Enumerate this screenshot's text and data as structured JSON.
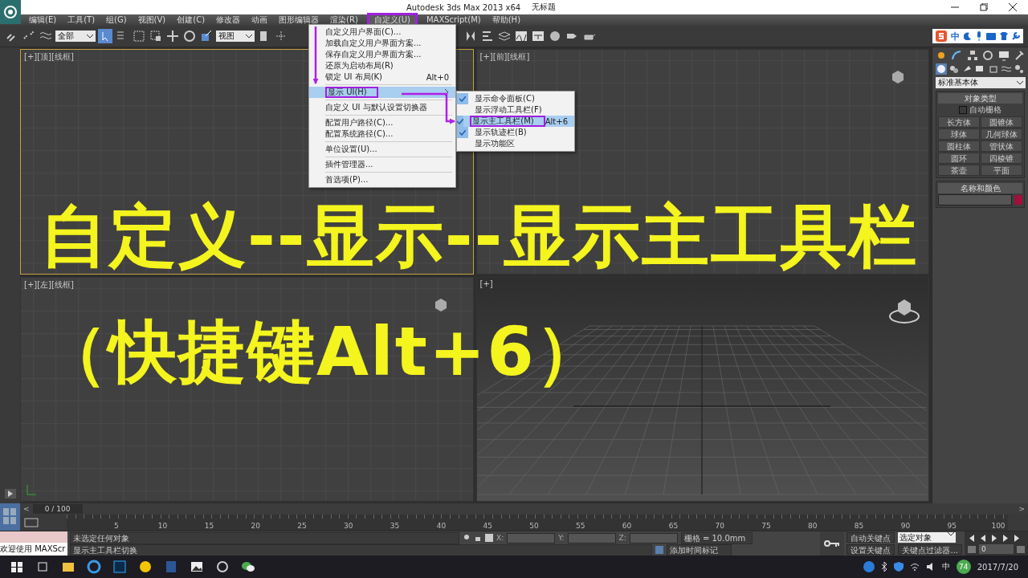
{
  "title_bar": {
    "app_title": "Autodesk 3ds Max  2013 x64",
    "document_title": "无标题"
  },
  "menu_bar": [
    {
      "label": "编辑(E)",
      "selected": false
    },
    {
      "label": "工具(T)",
      "selected": false
    },
    {
      "label": "组(G)",
      "selected": false
    },
    {
      "label": "视图(V)",
      "selected": false
    },
    {
      "label": "创建(C)",
      "selected": false
    },
    {
      "label": "修改器",
      "selected": false
    },
    {
      "label": "动画",
      "selected": false
    },
    {
      "label": "图形编辑器",
      "selected": false
    },
    {
      "label": "渲染(R)",
      "selected": false
    },
    {
      "label": "自定义(U)",
      "selected": true
    },
    {
      "label": "MAXScript(M)",
      "selected": false
    },
    {
      "label": "帮助(H)",
      "selected": false
    }
  ],
  "toolbar": {
    "selection_filter": "全部",
    "reference_coordinate": "视图"
  },
  "ime_bar": {
    "mode": "中"
  },
  "viewports": [
    {
      "label": "[+][顶][线框]",
      "kind": "grid"
    },
    {
      "label": "[+][前][线框]",
      "kind": "grid"
    },
    {
      "label": "[+][左][线框]",
      "kind": "grid"
    },
    {
      "label": "[+]",
      "kind": "perspective"
    }
  ],
  "customize_menu": [
    {
      "label": "自定义用户界面(C)...",
      "selected": false
    },
    {
      "label": "加载自定义用户界面方案...",
      "selected": false
    },
    {
      "label": "保存自定义用户界面方案...",
      "selected": false
    },
    {
      "label": "还原为启动布局(R)",
      "selected": false
    },
    {
      "label": "锁定 UI 布局(K)",
      "shortcut": "Alt+0",
      "selected": false,
      "separator_after": true
    },
    {
      "label": "显示 UI(H)",
      "submenu": true,
      "selected": true,
      "separator_after": true
    },
    {
      "label": "自定义 UI 与默认设置切换器",
      "selected": false,
      "separator_after": true
    },
    {
      "label": "配置用户路径(C)...",
      "selected": false
    },
    {
      "label": "配置系统路径(C)...",
      "selected": false,
      "separator_after": true
    },
    {
      "label": "单位设置(U)...",
      "selected": false,
      "separator_after": true
    },
    {
      "label": "插件管理器...",
      "selected": false,
      "separator_after": true
    },
    {
      "label": "首选项(P)...",
      "selected": false
    }
  ],
  "show_ui_submenu": [
    {
      "label": "显示命令面板(C)",
      "checked": true,
      "selected": false
    },
    {
      "label": "显示浮动工具栏(F)",
      "checked": false,
      "selected": false
    },
    {
      "label": "显示主工具栏(M)",
      "shortcut": "Alt+6",
      "checked": true,
      "selected": true
    },
    {
      "label": "显示轨迹栏(B)",
      "checked": true,
      "selected": false
    },
    {
      "label": "显示功能区",
      "checked": false,
      "selected": false
    }
  ],
  "caption": [
    "自定义--显示--显示主工具栏",
    "（快捷键Alt+6）"
  ],
  "command_panel": {
    "category": "标准基本体",
    "object_type_title": "对象类型",
    "auto_grid": {
      "label": "自动栅格",
      "checked": false
    },
    "object_buttons": [
      "长方体",
      "圆锥体",
      "球体",
      "几何球体",
      "圆柱体",
      "管状体",
      "圆环",
      "四棱锥",
      "茶壶",
      "平面"
    ],
    "name_color_title": "名称和颜色"
  },
  "timeline": {
    "position": "0 / 100",
    "prev": "<",
    "next": ">",
    "ticks": [
      "5",
      "10",
      "15",
      "20",
      "25",
      "30",
      "35",
      "40",
      "45",
      "50",
      "55",
      "60",
      "65",
      "70",
      "75",
      "80",
      "85",
      "90",
      "95",
      "100"
    ]
  },
  "status": {
    "listener_output": "欢迎使用 MAXScr",
    "selection": "未选定任何对象",
    "prompt": "显示主工具栏切换",
    "x_label": "X:",
    "y_label": "Y:",
    "z_label": "Z:",
    "grid": "栅格 = 10.0mm",
    "add_time_tag": "添加时间标记",
    "auto_key": "自动关键点",
    "key_mode": "选定对象",
    "set_key": "设置关键点",
    "key_filters": "关键点过滤器...",
    "frame": "0"
  },
  "taskbar": {
    "tray_lang": "中",
    "tray_badge": "74",
    "date": "2017/7/20"
  }
}
